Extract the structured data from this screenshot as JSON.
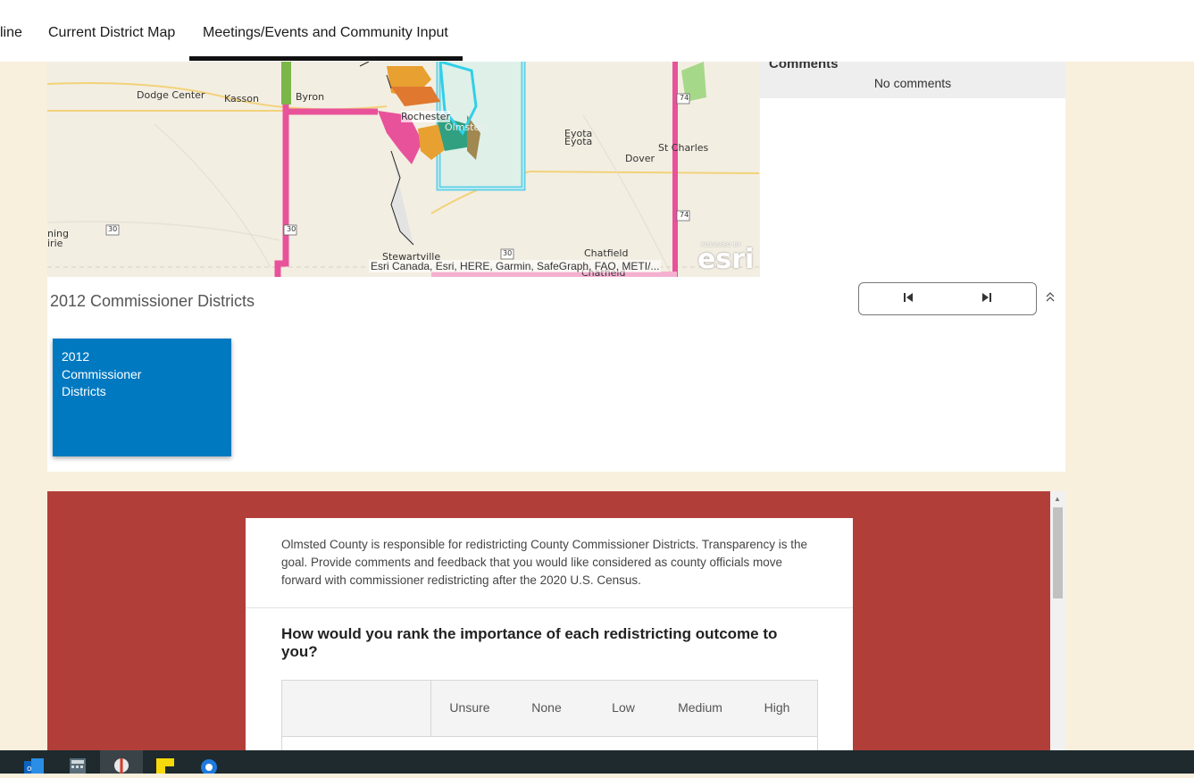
{
  "tabs": [
    {
      "label": "line"
    },
    {
      "label": "Current District Map"
    },
    {
      "label": "Meetings/Events and Community Input"
    }
  ],
  "map": {
    "places": [
      "Dodge Center",
      "Kasson",
      "Byron",
      "Rochester",
      "Olmsted",
      "Eyota",
      "Eyota",
      "Dover",
      "St Charles",
      "Stewartville",
      "Chatfield",
      "Chatfield",
      "ning",
      "irie"
    ],
    "road_shields": [
      "74",
      "74",
      "30",
      "30",
      "30"
    ],
    "attribution": "Esri Canada, Esri, HERE, Garmin, SafeGraph, FAO, METI/...",
    "logo_powered": "POWERED BY",
    "logo_word": "esri"
  },
  "comments": {
    "title": "Comments",
    "empty_text": "No comments"
  },
  "layer_panel": {
    "title": "2012 Commissioner Districts",
    "card_label": "2012 Commissioner Districts"
  },
  "survey": {
    "intro": "Olmsted County is responsible for redistricting County Commissioner Districts. Transparency is the goal. Provide comments and feedback that you would like considered as county officials move forward with commissioner redistricting after the 2020 U.S. Census.",
    "question": "How would you rank the importance of each redistricting outcome to you?",
    "columns": [
      "Unsure",
      "None",
      "Low",
      "Medium",
      "High"
    ]
  },
  "taskbar": {
    "icons": [
      "outlook-icon",
      "calculator-icon",
      "snipping-tool-icon",
      "sticky-notes-icon",
      "app-icon"
    ]
  }
}
